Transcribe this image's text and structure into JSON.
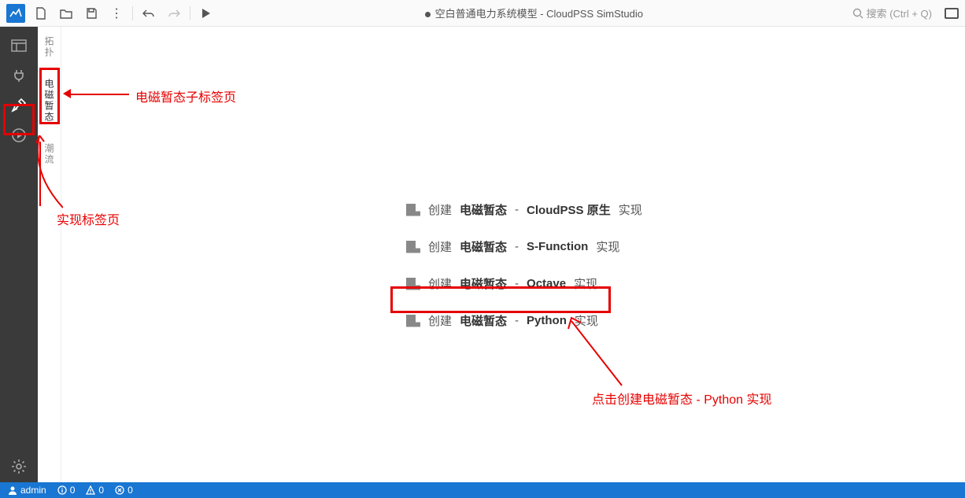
{
  "topbar": {
    "title_prefix": "空白普通电力系统模型 - ",
    "title_app": "CloudPSS SimStudio",
    "search_placeholder": "搜索 (Ctrl + Q)"
  },
  "vtabs": {
    "t0": "拓扑",
    "t1": "电磁暂态",
    "t2": "潮流"
  },
  "options": {
    "create": "创建",
    "cat": "电磁暂态",
    "impl": "实现",
    "o0": "CloudPSS 原生",
    "o1": "S-Function",
    "o2": "Octave",
    "o3": "Python"
  },
  "annotations": {
    "a0": "电磁暂态子标签页",
    "a1": "实现标签页",
    "a2": "点击创建电磁暂态 - Python 实现"
  },
  "status": {
    "user": "admin",
    "info_count": "0",
    "warn_count": "0",
    "err_count": "0"
  }
}
